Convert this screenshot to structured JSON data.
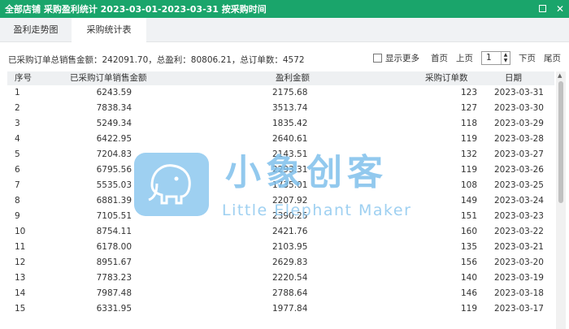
{
  "window": {
    "title": "全部店铺 采购盈利统计 2023-03-01-2023-03-31 按采购时间"
  },
  "tabs": [
    {
      "label": "盈利走势图"
    },
    {
      "label": "采购统计表"
    }
  ],
  "summary": {
    "text": "已采购订单总销售金额：242091.70，总盈利：80806.21，总订单数：4572"
  },
  "pager": {
    "show_more": "显示更多",
    "first": "首页",
    "prev": "上页",
    "page": "1",
    "next": "下页",
    "last": "尾页"
  },
  "table": {
    "headers": [
      "序号",
      "已采购订单销售金额",
      "盈利金额",
      "采购订单数",
      "日期"
    ],
    "rows": [
      [
        "1",
        "6243.59",
        "2175.68",
        "123",
        "2023-03-31"
      ],
      [
        "2",
        "7838.34",
        "3513.74",
        "127",
        "2023-03-30"
      ],
      [
        "3",
        "5249.34",
        "1835.42",
        "118",
        "2023-03-29"
      ],
      [
        "4",
        "6422.95",
        "2640.61",
        "119",
        "2023-03-28"
      ],
      [
        "5",
        "7204.83",
        "2143.51",
        "132",
        "2023-03-27"
      ],
      [
        "6",
        "6795.56",
        "2293.31",
        "119",
        "2023-03-26"
      ],
      [
        "7",
        "5535.03",
        "1735.01",
        "108",
        "2023-03-25"
      ],
      [
        "8",
        "6881.39",
        "2207.92",
        "149",
        "2023-03-24"
      ],
      [
        "9",
        "7105.51",
        "2390.25",
        "151",
        "2023-03-23"
      ],
      [
        "10",
        "8754.11",
        "2421.76",
        "160",
        "2023-03-22"
      ],
      [
        "11",
        "6178.00",
        "2103.95",
        "135",
        "2023-03-21"
      ],
      [
        "12",
        "8951.67",
        "2629.83",
        "156",
        "2023-03-20"
      ],
      [
        "13",
        "7783.23",
        "2220.54",
        "140",
        "2023-03-19"
      ],
      [
        "14",
        "7987.48",
        "2788.64",
        "146",
        "2023-03-18"
      ],
      [
        "15",
        "6331.95",
        "1977.84",
        "119",
        "2023-03-17"
      ]
    ]
  },
  "watermark": {
    "cn": "小象创客",
    "en": "Little Elephant Maker"
  }
}
